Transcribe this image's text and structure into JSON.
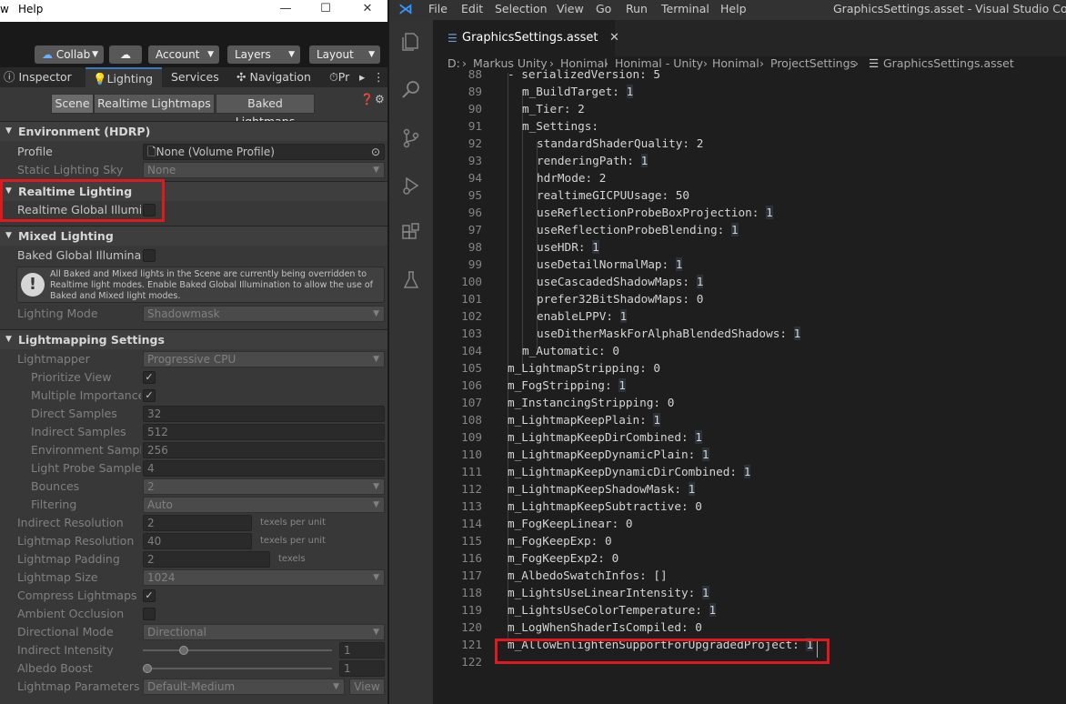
{
  "unity": {
    "menu": {
      "partial": "w",
      "help": "Help"
    },
    "toolbar": {
      "collab": "Collab",
      "account": "Account",
      "layers": "Layers",
      "layout": "Layout"
    },
    "tabs": {
      "inspector": "Inspector",
      "lighting": "Lighting",
      "services": "Services",
      "navigation": "Navigation",
      "pr": "Pr"
    },
    "subtabs": {
      "scene": "Scene",
      "realtime_lightmaps": "Realtime Lightmaps",
      "baked_lightmaps": "Baked Lightmaps"
    },
    "environment": {
      "header": "Environment (HDRP)",
      "profile_label": "Profile",
      "profile_value": "None (Volume Profile)",
      "static_sky_label": "Static Lighting Sky",
      "static_sky_value": "None"
    },
    "realtime": {
      "header": "Realtime Lighting",
      "gi_label": "Realtime Global Illuminat"
    },
    "mixed": {
      "header": "Mixed Lighting",
      "baked_gi_label": "Baked Global Illuminatio",
      "warning": "All Baked and Mixed lights in the Scene are currently being overridden to Realtime light modes. Enable Baked Global Illumination to allow the use of Baked and Mixed light modes.",
      "mode_label": "Lighting Mode",
      "mode_value": "Shadowmask"
    },
    "lightmapping": {
      "header": "Lightmapping Settings",
      "rows": [
        {
          "label": "Lightmapper",
          "value": "Progressive CPU"
        },
        {
          "label": "Prioritize View",
          "value": "✓"
        },
        {
          "label": "Multiple Importance S",
          "value": "✓"
        },
        {
          "label": "Direct Samples",
          "value": "32"
        },
        {
          "label": "Indirect Samples",
          "value": "512"
        },
        {
          "label": "Environment Samples",
          "value": "256"
        },
        {
          "label": "Light Probe Sample M",
          "value": "4"
        },
        {
          "label": "Bounces",
          "value": "2"
        },
        {
          "label": "Filtering",
          "value": "Auto"
        },
        {
          "label": "Indirect Resolution",
          "value": "2",
          "unit": "texels per unit"
        },
        {
          "label": "Lightmap Resolution",
          "value": "40",
          "unit": "texels per unit"
        },
        {
          "label": "Lightmap Padding",
          "value": "2",
          "unit": "texels"
        },
        {
          "label": "Lightmap Size",
          "value": "1024"
        },
        {
          "label": "Compress Lightmaps",
          "value": "✓"
        },
        {
          "label": "Ambient Occlusion",
          "value": ""
        },
        {
          "label": "Directional Mode",
          "value": "Directional"
        },
        {
          "label": "Indirect Intensity",
          "value": "1"
        },
        {
          "label": "Albedo Boost",
          "value": "1"
        },
        {
          "label": "Lightmap Parameters",
          "value": "Default-Medium",
          "button": "View"
        }
      ]
    }
  },
  "vscode": {
    "menu": [
      "File",
      "Edit",
      "Selection",
      "View",
      "Go",
      "Run",
      "Terminal",
      "Help"
    ],
    "title": "GraphicsSettings.asset - Visual Studio Code",
    "tab": "GraphicsSettings.asset",
    "breadcrumb": [
      "D:",
      "Markus Unity",
      "Honimal",
      "Honimal - Unity",
      "Honimal",
      "ProjectSettings",
      "GraphicsSettings.asset"
    ],
    "lines": [
      {
        "n": "88",
        "indent": 0,
        "key": "- serializedVersion:",
        "val": "5"
      },
      {
        "n": "89",
        "indent": 1,
        "key": "m_BuildTarget:",
        "val": "1",
        "hi": true
      },
      {
        "n": "90",
        "indent": 1,
        "key": "m_Tier:",
        "val": "2"
      },
      {
        "n": "91",
        "indent": 1,
        "key": "m_Settings:",
        "val": ""
      },
      {
        "n": "92",
        "indent": 2,
        "key": "standardShaderQuality:",
        "val": "2"
      },
      {
        "n": "93",
        "indent": 2,
        "key": "renderingPath:",
        "val": "1",
        "hi": true
      },
      {
        "n": "94",
        "indent": 2,
        "key": "hdrMode:",
        "val": "2"
      },
      {
        "n": "95",
        "indent": 2,
        "key": "realtimeGICPUUsage:",
        "val": "50"
      },
      {
        "n": "96",
        "indent": 2,
        "key": "useReflectionProbeBoxProjection:",
        "val": "1",
        "hi": true
      },
      {
        "n": "97",
        "indent": 2,
        "key": "useReflectionProbeBlending:",
        "val": "1",
        "hi": true
      },
      {
        "n": "98",
        "indent": 2,
        "key": "useHDR:",
        "val": "1",
        "hi": true
      },
      {
        "n": "99",
        "indent": 2,
        "key": "useDetailNormalMap:",
        "val": "1",
        "hi": true
      },
      {
        "n": "100",
        "indent": 2,
        "key": "useCascadedShadowMaps:",
        "val": "1",
        "hi": true
      },
      {
        "n": "101",
        "indent": 2,
        "key": "prefer32BitShadowMaps:",
        "val": "0"
      },
      {
        "n": "102",
        "indent": 2,
        "key": "enableLPPV:",
        "val": "1",
        "hi": true
      },
      {
        "n": "103",
        "indent": 2,
        "key": "useDitherMaskForAlphaBlendedShadows:",
        "val": "1",
        "hi": true
      },
      {
        "n": "104",
        "indent": 1,
        "key": "m_Automatic:",
        "val": "0"
      },
      {
        "n": "105",
        "indent": 0,
        "key": "m_LightmapStripping:",
        "val": "0"
      },
      {
        "n": "106",
        "indent": 0,
        "key": "m_FogStripping:",
        "val": "1",
        "hi": true
      },
      {
        "n": "107",
        "indent": 0,
        "key": "m_InstancingStripping:",
        "val": "0"
      },
      {
        "n": "108",
        "indent": 0,
        "key": "m_LightmapKeepPlain:",
        "val": "1",
        "hi": true
      },
      {
        "n": "109",
        "indent": 0,
        "key": "m_LightmapKeepDirCombined:",
        "val": "1",
        "hi": true
      },
      {
        "n": "110",
        "indent": 0,
        "key": "m_LightmapKeepDynamicPlain:",
        "val": "1",
        "hi": true
      },
      {
        "n": "111",
        "indent": 0,
        "key": "m_LightmapKeepDynamicDirCombined:",
        "val": "1",
        "hi": true
      },
      {
        "n": "112",
        "indent": 0,
        "key": "m_LightmapKeepShadowMask:",
        "val": "1",
        "hi": true
      },
      {
        "n": "113",
        "indent": 0,
        "key": "m_LightmapKeepSubtractive:",
        "val": "0"
      },
      {
        "n": "114",
        "indent": 0,
        "key": "m_FogKeepLinear:",
        "val": "0"
      },
      {
        "n": "115",
        "indent": 0,
        "key": "m_FogKeepExp:",
        "val": "0"
      },
      {
        "n": "116",
        "indent": 0,
        "key": "m_FogKeepExp2:",
        "val": "0"
      },
      {
        "n": "117",
        "indent": 0,
        "key": "m_AlbedoSwatchInfos:",
        "val": "[]"
      },
      {
        "n": "118",
        "indent": 0,
        "key": "m_LightsUseLinearIntensity:",
        "val": "1",
        "hi": true
      },
      {
        "n": "119",
        "indent": 0,
        "key": "m_LightsUseColorTemperature:",
        "val": "1",
        "hi": true
      },
      {
        "n": "120",
        "indent": 0,
        "key": "m_LogWhenShaderIsCompiled:",
        "val": "0"
      },
      {
        "n": "121",
        "indent": 0,
        "key": "m_AllowEnlightenSupportForUpgradedProject:",
        "val": "1",
        "hi": true
      },
      {
        "n": "122",
        "indent": 0,
        "key": "",
        "val": ""
      }
    ]
  },
  "colors": {
    "highlight": "#e0191f",
    "unity_bg": "#383838",
    "vscode_bg": "#1e1e1e",
    "accent": "#3a79bb"
  }
}
